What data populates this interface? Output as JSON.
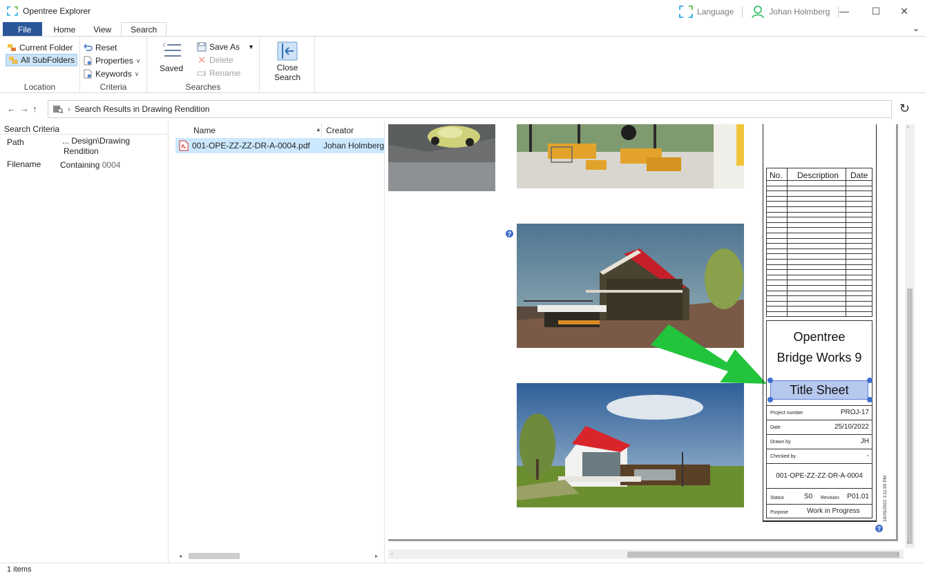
{
  "window": {
    "title": "Opentree Explorer",
    "language_label": "Language",
    "user_name": "Johan Holmberg",
    "minimize_glyph": "—",
    "maximize_glyph": "☐",
    "close_glyph": "✕",
    "collapse_glyph": "⌄"
  },
  "tabs": [
    {
      "label": "File",
      "active": false
    },
    {
      "label": "Home",
      "active": false
    },
    {
      "label": "View",
      "active": false
    },
    {
      "label": "Search",
      "active": true
    }
  ],
  "ribbon": {
    "location": {
      "label": "Location",
      "current_folder": "Current Folder",
      "all_subfolders": "All SubFolders"
    },
    "criteria": {
      "label": "Criteria",
      "reset": "Reset",
      "properties": "Properties",
      "keywords": "Keywords"
    },
    "searches": {
      "label": "Searches",
      "saved": "Saved",
      "save_as": "Save As",
      "delete": "Delete",
      "rename": "Rename"
    },
    "close_search": "Close Search"
  },
  "address": {
    "text": "Search Results in  Drawing Rendition",
    "separator": "›"
  },
  "search_criteria": {
    "header": "Search Criteria",
    "rows": [
      {
        "key": "Path",
        "value": "... Design\\Drawing",
        "value2": "Rendition"
      },
      {
        "key": "Filename",
        "value": "Containing",
        "value_extra": "0004"
      }
    ]
  },
  "file_list": {
    "columns": [
      "Name",
      "Creator"
    ],
    "sort_glyph": "▲",
    "rows": [
      {
        "name": "001-OPE-ZZ-ZZ-DR-A-0004.pdf",
        "creator": "Johan Holmberg"
      }
    ]
  },
  "preview": {
    "help_glyph": "?",
    "revision_table": {
      "headers": [
        "No.",
        "Description",
        "Date"
      ]
    },
    "company_line1": "Opentree",
    "company_line2": "Bridge Works 9",
    "sheet_title": "Title Sheet",
    "fields": [
      {
        "label": "Project number",
        "value": "PROJ-17"
      },
      {
        "label": "Date",
        "value": "25/10/2022"
      },
      {
        "label": "Drawn by",
        "value": "JH"
      },
      {
        "label": "Checked by",
        "value": "-"
      }
    ],
    "document_number": "001-OPE-ZZ-ZZ-DR-A-0004",
    "status_label": "Status",
    "status_value": "S0",
    "revision_label": "Revision",
    "revision_value": "P01.01",
    "purpose_label": "Purpose",
    "purpose_value": "Work in Progress",
    "timestamp": "10/25/2022 3:11:55 PM"
  },
  "status_bar": {
    "items_text": "1 items"
  },
  "colors": {
    "file_tab": "#2b579a",
    "selection": "#cce8ff",
    "accent_arrow": "#22c43c",
    "roof_red": "#d8252c",
    "handle_blue": "#3e6fd1"
  }
}
